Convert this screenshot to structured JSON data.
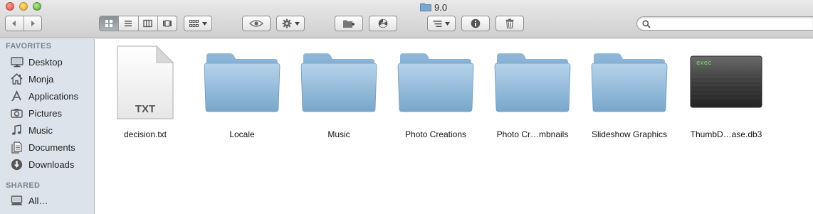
{
  "window": {
    "title": "9.0"
  },
  "search": {
    "value": "",
    "placeholder": ""
  },
  "sidebar": {
    "favorites_heading": "FAVORITES",
    "shared_heading": "SHARED",
    "favorites": [
      {
        "label": "Desktop",
        "icon": "desktop-icon"
      },
      {
        "label": "Monja",
        "icon": "home-icon"
      },
      {
        "label": "Applications",
        "icon": "applications-icon"
      },
      {
        "label": "Pictures",
        "icon": "camera-icon"
      },
      {
        "label": "Music",
        "icon": "music-note-icon"
      },
      {
        "label": "Documents",
        "icon": "documents-icon"
      },
      {
        "label": "Downloads",
        "icon": "download-icon"
      }
    ],
    "shared": [
      {
        "label": "All…",
        "icon": "network-computer-icon"
      }
    ]
  },
  "files": [
    {
      "name": "decision.txt",
      "kind": "txt-document",
      "badge": "TXT"
    },
    {
      "name": "Locale",
      "kind": "folder"
    },
    {
      "name": "Music",
      "kind": "folder"
    },
    {
      "name": "Photo Creations",
      "kind": "folder"
    },
    {
      "name": "Photo Cr…mbnails",
      "kind": "folder"
    },
    {
      "name": "Slideshow Graphics",
      "kind": "folder"
    },
    {
      "name": "ThumbD…ase.db3",
      "kind": "executable",
      "badge": "exec"
    }
  ],
  "colors": {
    "folder": "#8fb6d6",
    "sidebar_bg": "#dde3ea",
    "sidebar_heading": "#7b838c"
  }
}
